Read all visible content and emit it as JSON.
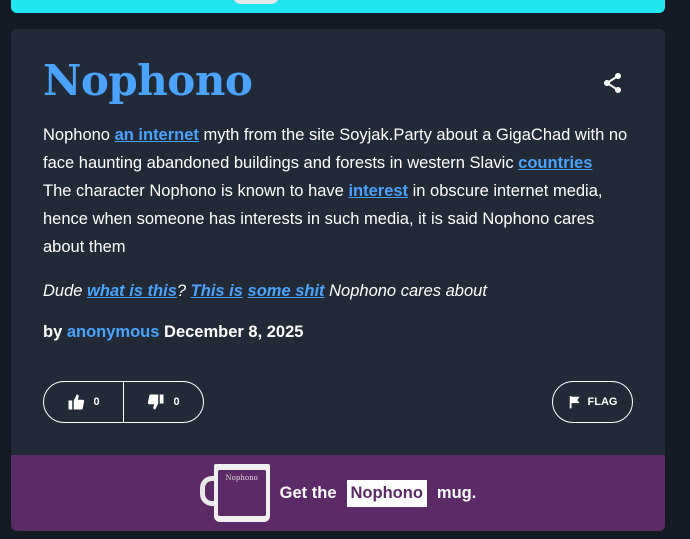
{
  "entry": {
    "word": "Nophono",
    "definition": {
      "parts": [
        "Nophono ",
        "an internet",
        " myth from the site Soyjak.Party about a GigaChad with no face haunting abandoned buildings and forests in western Slavic ",
        "countries",
        " The character Nophono is known to have ",
        "interest",
        " in obscure internet media, hence when someone has interests in such media, it is said Nophono cares about them"
      ]
    },
    "example": {
      "parts": [
        "Dude ",
        "what is this",
        "? ",
        "This is",
        " ",
        "some shit",
        " Nophono cares about"
      ]
    },
    "byline": {
      "prefix": "by ",
      "author": "anonymous",
      "date": " December 8, 2025"
    },
    "votes": {
      "up": "0",
      "down": "0"
    },
    "flag_label": "FLAG"
  },
  "promo": {
    "mug_print": "Nophono",
    "prefix": "Get the",
    "word": "Nophono",
    "suffix": "mug."
  },
  "colors": {
    "link": "#4aa3ff",
    "card": "#212a36",
    "promo": "#5c2a66",
    "banner": "#1fe6f0"
  }
}
